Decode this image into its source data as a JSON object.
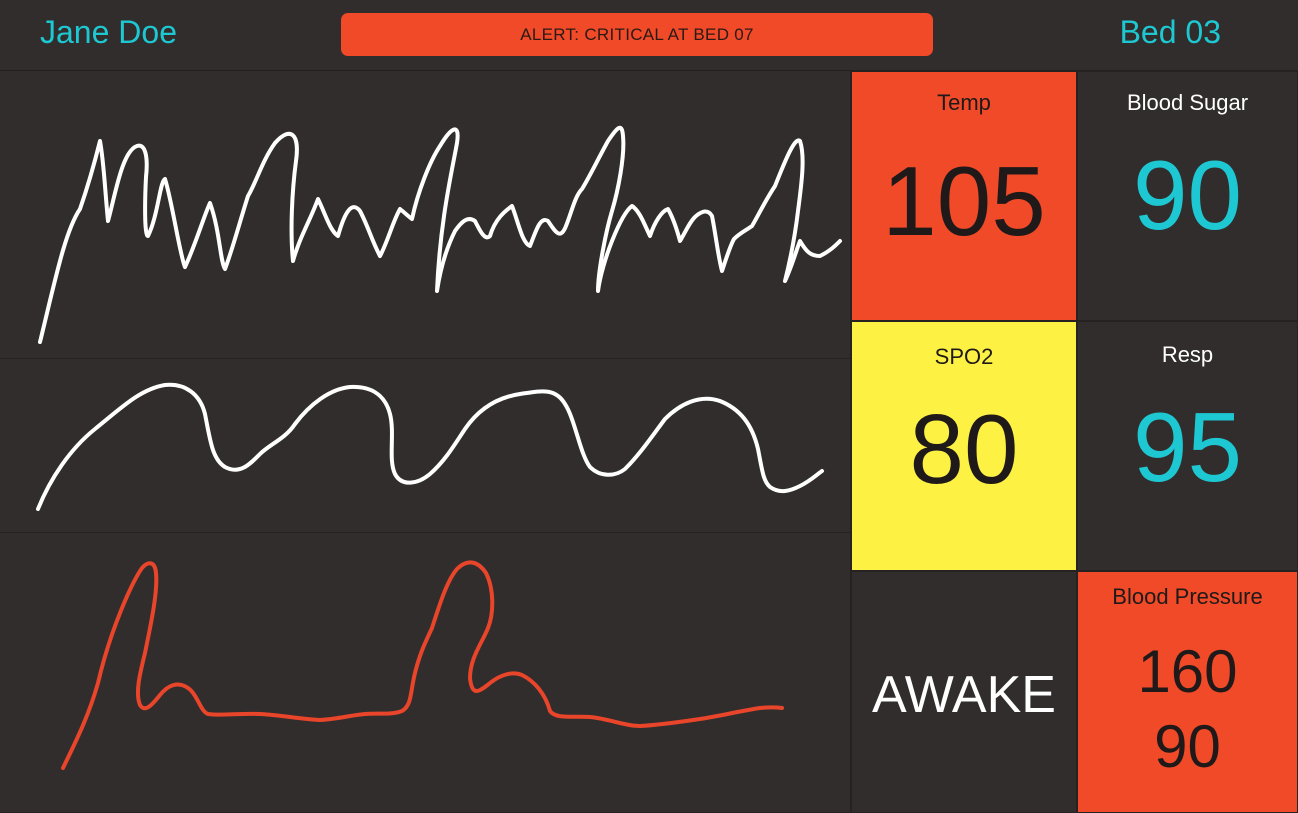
{
  "header": {
    "patient_name": "Jane Doe",
    "alert_text": "ALERT: CRITICAL AT BED 07",
    "bed_label": "Bed 03"
  },
  "vitals": {
    "temp": {
      "label": "Temp",
      "value": "105",
      "status": "critical"
    },
    "blood_sugar": {
      "label": "Blood Sugar",
      "value": "90",
      "status": "normal"
    },
    "spo2": {
      "label": "SPO2",
      "value": "80",
      "status": "warning"
    },
    "resp": {
      "label": "Resp",
      "value": "95",
      "status": "normal"
    },
    "state": {
      "value": "AWAKE"
    },
    "blood_pressure": {
      "label": "Blood Pressure",
      "systolic": "160",
      "diastolic": "90",
      "status": "critical"
    }
  },
  "waveforms": [
    {
      "name": "waveform-1",
      "color": "#ffffff"
    },
    {
      "name": "waveform-2",
      "color": "#ffffff"
    },
    {
      "name": "waveform-3",
      "color": "#e8452a"
    }
  ],
  "colors": {
    "background": "#312d2c",
    "accent": "#1ec8d2",
    "critical": "#f04a28",
    "warning": "#fdf243"
  }
}
